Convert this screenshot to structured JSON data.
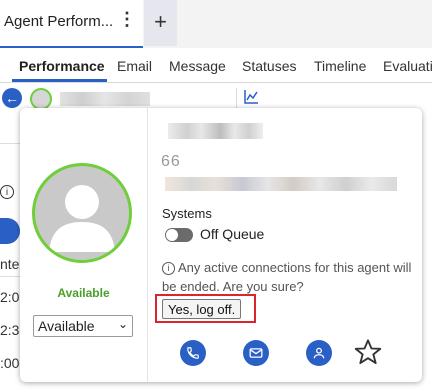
{
  "tabs": {
    "active_title": "Agent Perform...",
    "menu_glyph": "⋮",
    "add_glyph": "+"
  },
  "subnav": {
    "items": [
      "Performance",
      "Email",
      "Message",
      "Statuses",
      "Timeline",
      "Evaluati"
    ]
  },
  "background": {
    "left_fragments": [
      "i",
      "nter",
      "2:0",
      "2:3",
      ":00"
    ]
  },
  "popup": {
    "extension": "66",
    "systems_label": "Systems",
    "queue_status": "Off Queue",
    "warning_text": "Any active connections for this agent will be ended. Are you sure?",
    "confirm_button": "Yes, log off.",
    "presence": "Available",
    "status_select_value": "Available",
    "actions": [
      "phone-icon",
      "email-icon",
      "profile-icon",
      "favorite-star-icon"
    ]
  },
  "colors": {
    "accent": "#2a60c6",
    "presence_green": "#6fce3a",
    "available_text": "#4a9e2a",
    "highlight_red": "#d9262c"
  }
}
